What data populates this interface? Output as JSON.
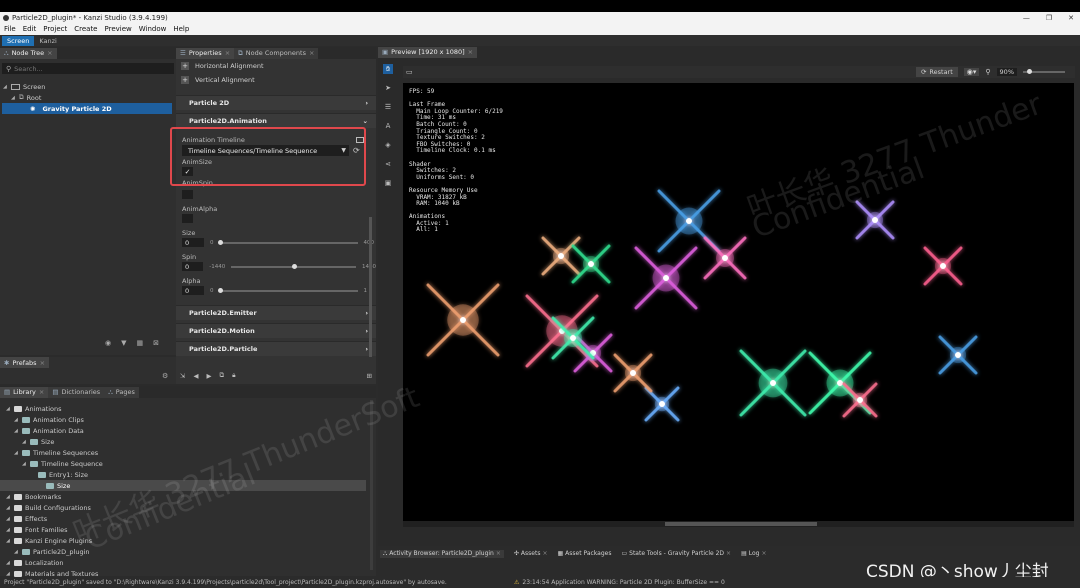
{
  "window": {
    "title": "Particle2D_plugin* - Kanzi Studio (3.9.4.199)",
    "minimize": "—",
    "maximize": "❐",
    "close": "✕"
  },
  "menu": [
    "File",
    "Edit",
    "Project",
    "Create",
    "Preview",
    "Window",
    "Help"
  ],
  "workspace_tabs": [
    "Screen",
    "Kanzi"
  ],
  "node_tree": {
    "tab": "Node Tree",
    "search_placeholder": "Search...",
    "items": [
      {
        "label": "Screen",
        "depth": 0
      },
      {
        "label": "Root",
        "depth": 1
      },
      {
        "label": "Gravity Particle 2D",
        "depth": 2,
        "selected": true
      }
    ]
  },
  "prefabs_tab": "Prefabs",
  "properties": {
    "tabs": [
      "Properties",
      "Node Components"
    ],
    "top_items": [
      "Horizontal Alignment",
      "Vertical Alignment"
    ],
    "sections": [
      "Particle 2D",
      "Particle2D.Animation",
      "Particle2D.Emitter",
      "Particle2D.Motion",
      "Particle2D.Particle"
    ],
    "animation_timeline_label": "Animation Timeline",
    "animation_timeline_value": "Timeline Sequences/Timeline Sequence",
    "anim_size_label": "AnimSize",
    "anim_size_checked": "✓",
    "anim_spin_label": "AnimSpin",
    "anim_alpha_label": "AnimAlpha",
    "size": {
      "label": "Size",
      "value": "0",
      "min": "0",
      "max": "400",
      "level": 0
    },
    "spin": {
      "label": "Spin",
      "value": "0",
      "min": "-1440",
      "max": "1440",
      "level": 0.5
    },
    "alpha": {
      "label": "Alpha",
      "value": "0",
      "min": "0",
      "max": "1",
      "level": 0
    }
  },
  "library": {
    "tabs": [
      "Library",
      "Dictionaries",
      "Pages"
    ],
    "items": [
      {
        "label": "Animations",
        "depth": 0
      },
      {
        "label": "Animation Clips",
        "depth": 1
      },
      {
        "label": "Animation Data",
        "depth": 1
      },
      {
        "label": "Size",
        "depth": 2
      },
      {
        "label": "Timeline Sequences",
        "depth": 1
      },
      {
        "label": "Timeline Sequence",
        "depth": 2
      },
      {
        "label": "Entry1: Size",
        "depth": 3
      },
      {
        "label": "Size",
        "depth": 4,
        "selected": true
      },
      {
        "label": "Bookmarks",
        "depth": 0
      },
      {
        "label": "Build Configurations",
        "depth": 0
      },
      {
        "label": "Effects",
        "depth": 0
      },
      {
        "label": "Font Families",
        "depth": 0
      },
      {
        "label": "Kanzi Engine Plugins",
        "depth": 0
      },
      {
        "label": "Particle2D_plugin",
        "depth": 1
      },
      {
        "label": "Localization",
        "depth": 0
      },
      {
        "label": "Materials and Textures",
        "depth": 0
      }
    ]
  },
  "preview": {
    "tab": "Preview [1920 x 1080]",
    "restart_label": "Restart",
    "zoom": "90%",
    "stats": "FPS: 59\n\nLast Frame\n  Main Loop Counter: 6/219\n  Time: 31 ms\n  Batch Count: 0\n  Triangle Count: 0\n  Texture Switches: 2\n  FBO Switches: 0\n  Timeline Clock: 0.1 ms\n\nShader\n  Switches: 2\n  Uniforms Sent: 0\n\nResource Memory Use\n  VRAM: 31827 kB\n  RAM: 1040 kB\n\nAnimations\n  Active: 1\n  All: 1"
  },
  "watermarks": [
    "叶长华 3277 Thunder",
    "Confidential",
    "叶长华 3277 ThunderSoft",
    "Confidential"
  ],
  "bottom_tabs": [
    "Activity Browser: Particle2D_plugin",
    "Assets",
    "Asset Packages",
    "State Tools - Gravity Particle 2D",
    "Log"
  ],
  "status": {
    "left": "Project \"Particle2D_plugin\" saved to \"D:\\Rightware\\Kanzi 3.9.4.199\\Projects\\particle2d\\Tool_project\\Particle2D_plugin.kzproj.autosave\" by autosave.",
    "right": "23:14:54 Application WARNING: Particle 2D Plugin: BufferSize == 0"
  },
  "csdn_watermark": "CSDN @丶show丿尘封",
  "colors": {
    "accent": "#1e5f9e",
    "highlight": "#e0484c"
  },
  "sparkles": [
    {
      "color": "#4aa0e8"
    },
    {
      "color": "#e060e0"
    },
    {
      "color": "#f0a070"
    },
    {
      "color": "#ff7090"
    },
    {
      "color": "#40f0b0"
    },
    {
      "color": "#f0b080"
    },
    {
      "color": "#30e090"
    },
    {
      "color": "#b090ff"
    },
    {
      "color": "#ff70c0"
    },
    {
      "color": "#6ab0ff"
    },
    {
      "color": "#40ffb0"
    },
    {
      "color": "#ff6090"
    }
  ]
}
